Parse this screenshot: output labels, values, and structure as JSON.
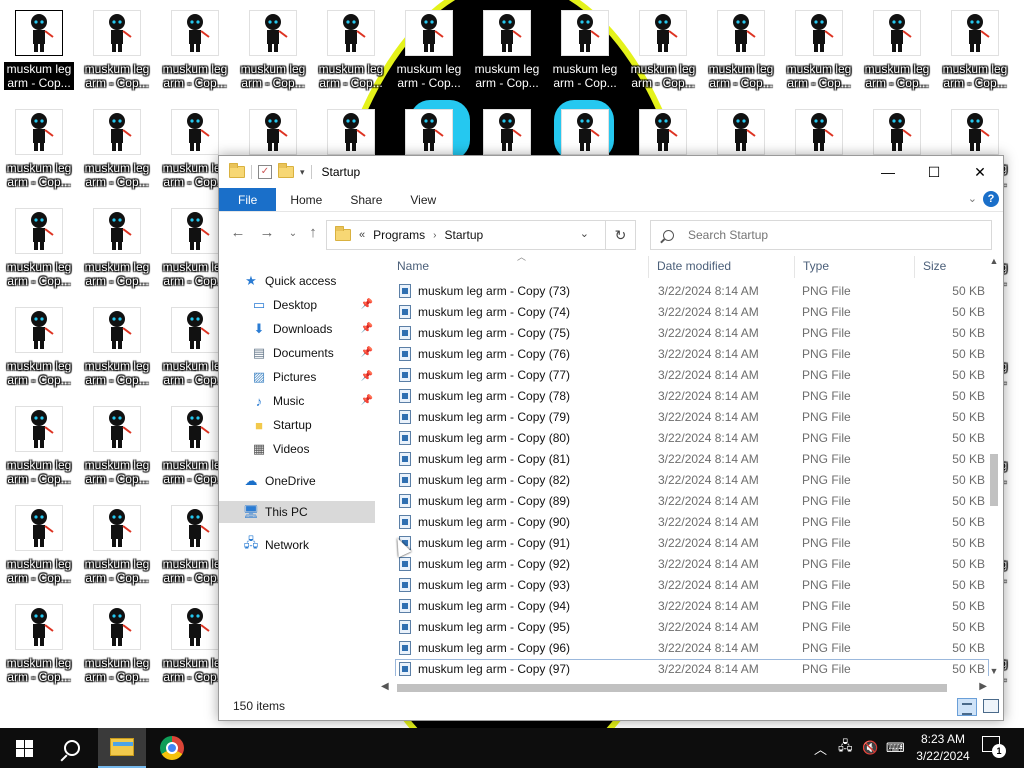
{
  "desktop": {
    "icon_label": "muskum leg arm - Cop...",
    "colors": {
      "wallpaper_face": "#000000",
      "wallpaper_outline": "#e4f21a",
      "wallpaper_eye": "#25c8f0"
    }
  },
  "window": {
    "title": "Startup",
    "controls": {
      "minimize": "—",
      "maximize": "☐",
      "close": "✕"
    },
    "ribbon_tabs": [
      "File",
      "Home",
      "Share",
      "View"
    ],
    "help": "?",
    "address": {
      "prefix": "«",
      "crumbs": [
        "Programs",
        "Startup"
      ]
    },
    "search": {
      "placeholder": "Search Startup"
    },
    "columns": {
      "name": "Name",
      "date": "Date modified",
      "type": "Type",
      "size": "Size"
    },
    "nav": {
      "quick_access": "Quick access",
      "pinned": [
        "Desktop",
        "Downloads",
        "Documents",
        "Pictures",
        "Music"
      ],
      "unpinned": [
        "Startup",
        "Videos"
      ],
      "onedrive": "OneDrive",
      "this_pc": "This PC",
      "network": "Network"
    },
    "files": [
      {
        "name": "muskum leg arm - Copy (73)",
        "date": "3/22/2024 8:14 AM",
        "type": "PNG File",
        "size": "50 KB"
      },
      {
        "name": "muskum leg arm - Copy (74)",
        "date": "3/22/2024 8:14 AM",
        "type": "PNG File",
        "size": "50 KB"
      },
      {
        "name": "muskum leg arm - Copy (75)",
        "date": "3/22/2024 8:14 AM",
        "type": "PNG File",
        "size": "50 KB"
      },
      {
        "name": "muskum leg arm - Copy (76)",
        "date": "3/22/2024 8:14 AM",
        "type": "PNG File",
        "size": "50 KB"
      },
      {
        "name": "muskum leg arm - Copy (77)",
        "date": "3/22/2024 8:14 AM",
        "type": "PNG File",
        "size": "50 KB"
      },
      {
        "name": "muskum leg arm - Copy (78)",
        "date": "3/22/2024 8:14 AM",
        "type": "PNG File",
        "size": "50 KB"
      },
      {
        "name": "muskum leg arm - Copy (79)",
        "date": "3/22/2024 8:14 AM",
        "type": "PNG File",
        "size": "50 KB"
      },
      {
        "name": "muskum leg arm - Copy (80)",
        "date": "3/22/2024 8:14 AM",
        "type": "PNG File",
        "size": "50 KB"
      },
      {
        "name": "muskum leg arm - Copy (81)",
        "date": "3/22/2024 8:14 AM",
        "type": "PNG File",
        "size": "50 KB"
      },
      {
        "name": "muskum leg arm - Copy (82)",
        "date": "3/22/2024 8:14 AM",
        "type": "PNG File",
        "size": "50 KB"
      },
      {
        "name": "muskum leg arm - Copy (89)",
        "date": "3/22/2024 8:14 AM",
        "type": "PNG File",
        "size": "50 KB"
      },
      {
        "name": "muskum leg arm - Copy (90)",
        "date": "3/22/2024 8:14 AM",
        "type": "PNG File",
        "size": "50 KB"
      },
      {
        "name": "muskum leg arm - Copy (91)",
        "date": "3/22/2024 8:14 AM",
        "type": "PNG File",
        "size": "50 KB"
      },
      {
        "name": "muskum leg arm - Copy (92)",
        "date": "3/22/2024 8:14 AM",
        "type": "PNG File",
        "size": "50 KB"
      },
      {
        "name": "muskum leg arm - Copy (93)",
        "date": "3/22/2024 8:14 AM",
        "type": "PNG File",
        "size": "50 KB"
      },
      {
        "name": "muskum leg arm - Copy (94)",
        "date": "3/22/2024 8:14 AM",
        "type": "PNG File",
        "size": "50 KB"
      },
      {
        "name": "muskum leg arm - Copy (95)",
        "date": "3/22/2024 8:14 AM",
        "type": "PNG File",
        "size": "50 KB"
      },
      {
        "name": "muskum leg arm - Copy (96)",
        "date": "3/22/2024 8:14 AM",
        "type": "PNG File",
        "size": "50 KB"
      },
      {
        "name": "muskum leg arm - Copy (97)",
        "date": "3/22/2024 8:14 AM",
        "type": "PNG File",
        "size": "50 KB"
      }
    ],
    "status": "150 items",
    "colors": {
      "accent": "#1a6fc9",
      "selected_nav": "#d9d9d9",
      "header_text": "#4c607a"
    }
  },
  "taskbar": {
    "time": "8:23 AM",
    "date": "3/22/2024",
    "notifications": "1",
    "tray_icons": [
      "chevron-up-icon",
      "network-icon",
      "volume-muted-icon",
      "ime-icon"
    ]
  }
}
